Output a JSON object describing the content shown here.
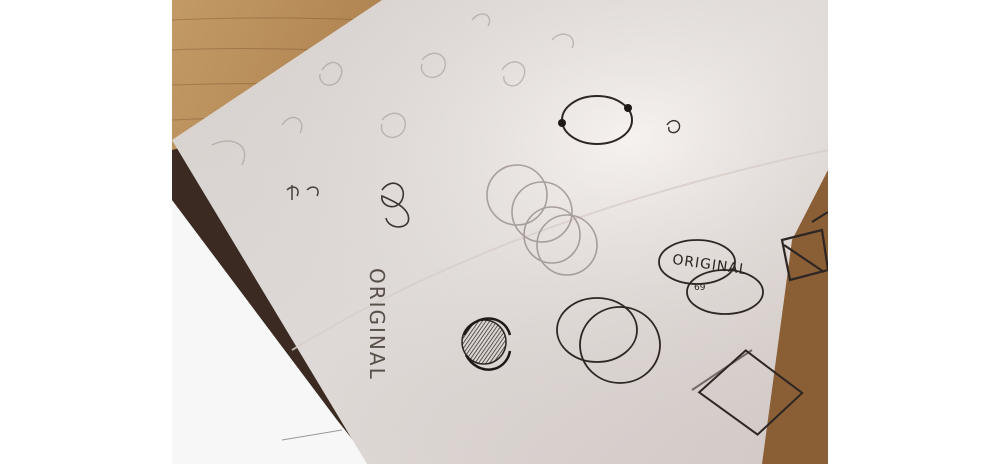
{
  "photo": {
    "description_alt": "",
    "sketch_label_original": "ORIGINAL",
    "sketch_label_number": "69",
    "sketch_vertical_text": "ORIGINAL",
    "colors": {
      "wood_light": "#b88f5e",
      "wood_dark": "#8a6239",
      "paper": "#f1ebe8",
      "pencil": "#2e2622",
      "white_sheet": "#f7f7f7"
    }
  }
}
